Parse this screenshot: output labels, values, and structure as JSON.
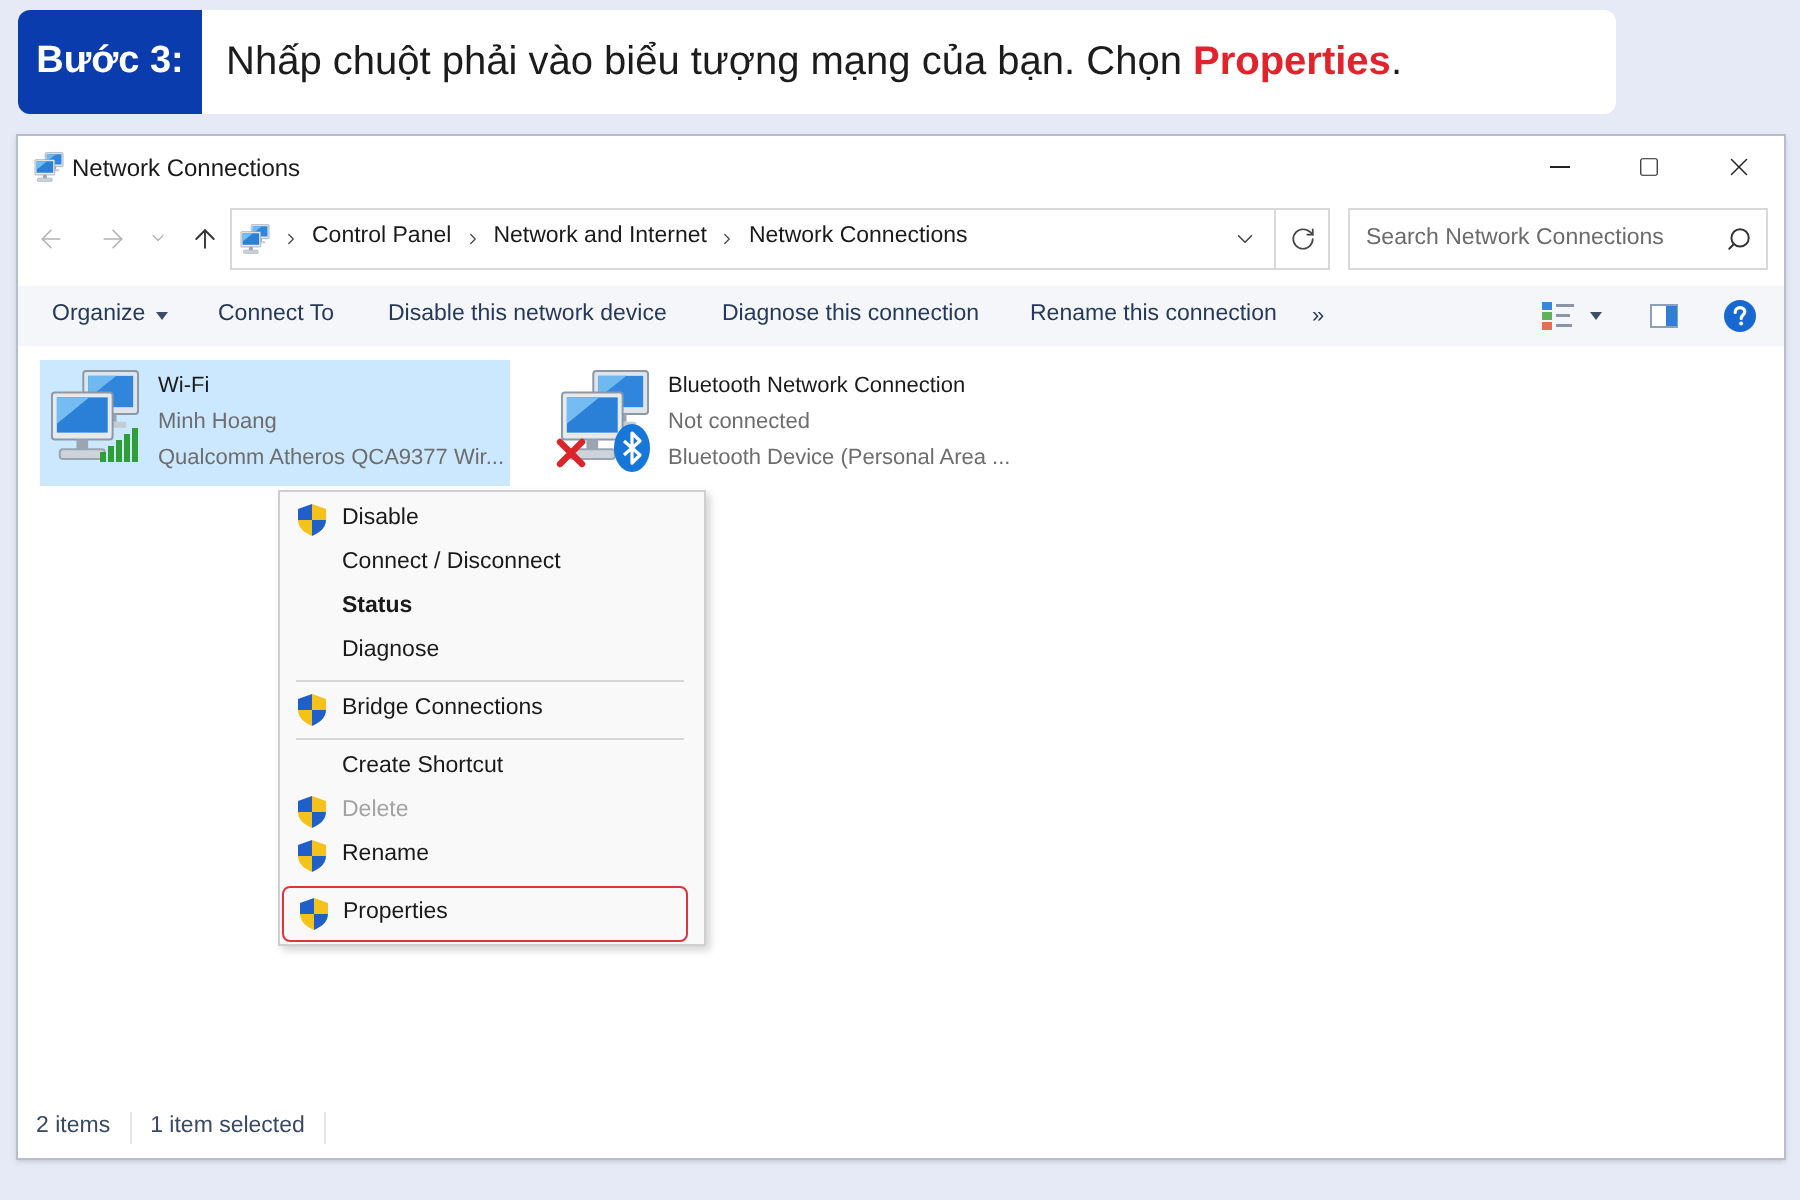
{
  "banner": {
    "step": "Bước 3:",
    "instruction": "Nhấp chuột phải vào biểu tượng mạng của bạn. Chọn **Properties**."
  },
  "window": {
    "title": "Network Connections"
  },
  "address_bar": {
    "breadcrumbs": [
      "Control Panel",
      "Network and Internet",
      "Network Connections"
    ]
  },
  "search": {
    "placeholder": "Search Network Connections"
  },
  "command_bar": {
    "items": [
      {
        "label": "Organize",
        "has_menu": true
      },
      {
        "label": "Connect To",
        "has_menu": false
      },
      {
        "label": "Disable this network device",
        "has_menu": false
      },
      {
        "label": "Diagnose this connection",
        "has_menu": false
      },
      {
        "label": "Rename this connection",
        "has_menu": false
      }
    ],
    "overflow": "»"
  },
  "connections": [
    {
      "kind": "wifi",
      "name": "Wi-Fi",
      "status": "Minh Hoang",
      "device": "Qualcomm Atheros QCA9377 Wir...",
      "connected": true,
      "selected": true
    },
    {
      "kind": "bluetooth",
      "name": "Bluetooth Network Connection",
      "status": "Not connected",
      "device": "Bluetooth Device (Personal Area ...",
      "connected": false,
      "selected": false
    }
  ],
  "context_menu": {
    "items": [
      {
        "kind": "item",
        "label": "Disable",
        "shield": true,
        "default": false,
        "disabled": false,
        "highlighted": false
      },
      {
        "kind": "item",
        "label": "Connect / Disconnect",
        "shield": false,
        "default": false,
        "disabled": false,
        "highlighted": false
      },
      {
        "kind": "item",
        "label": "Status",
        "shield": false,
        "default": true,
        "disabled": false,
        "highlighted": false
      },
      {
        "kind": "item",
        "label": "Diagnose",
        "shield": false,
        "default": false,
        "disabled": false,
        "highlighted": false
      },
      {
        "kind": "separator"
      },
      {
        "kind": "item",
        "label": "Bridge Connections",
        "shield": true,
        "default": false,
        "disabled": false,
        "highlighted": false
      },
      {
        "kind": "separator"
      },
      {
        "kind": "item",
        "label": "Create Shortcut",
        "shield": false,
        "default": false,
        "disabled": false,
        "highlighted": false
      },
      {
        "kind": "item",
        "label": "Delete",
        "shield": true,
        "default": false,
        "disabled": true,
        "highlighted": false
      },
      {
        "kind": "item",
        "label": "Rename",
        "shield": true,
        "default": false,
        "disabled": false,
        "highlighted": false
      },
      {
        "kind": "item",
        "label": "Properties",
        "shield": true,
        "default": false,
        "disabled": false,
        "highlighted": true
      }
    ]
  },
  "status_bar": [
    "2 items",
    "1 item selected"
  ]
}
